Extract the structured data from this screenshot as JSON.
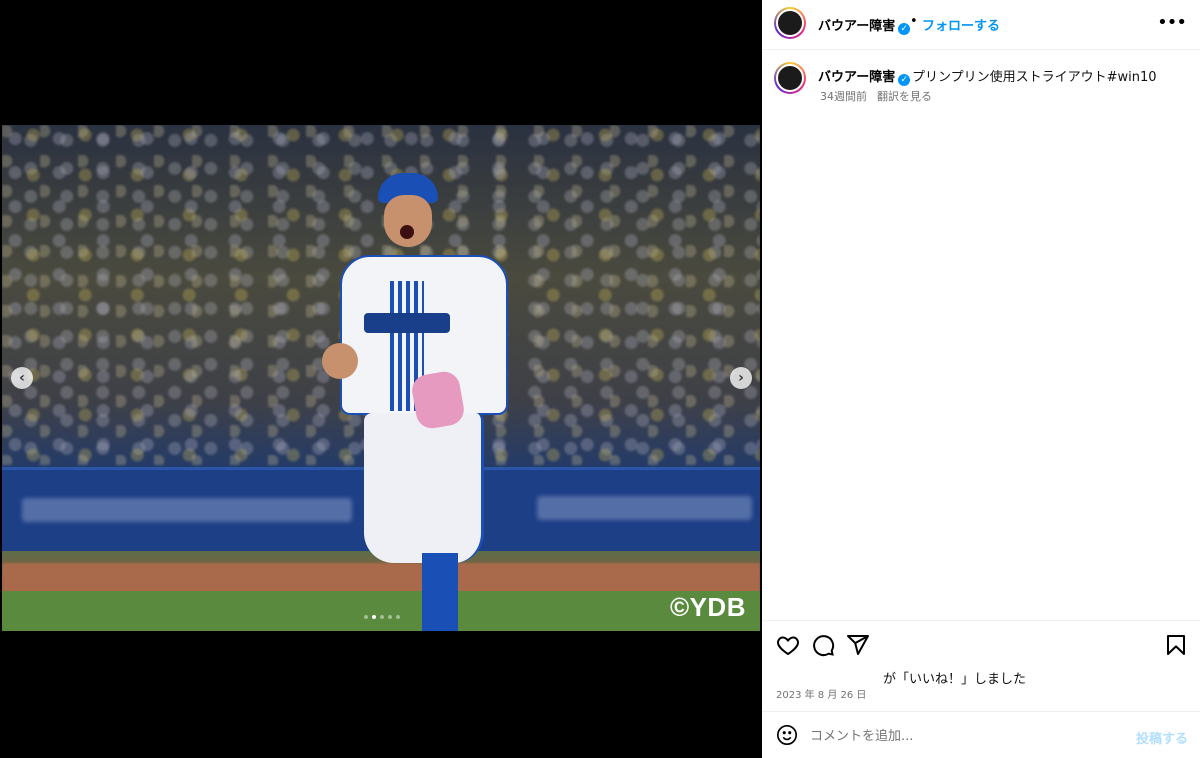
{
  "media": {
    "watermark": "©YDB",
    "carousel": {
      "dot_count": 5,
      "active_index": 1
    },
    "prev_glyph": "‹",
    "next_glyph": "›"
  },
  "header": {
    "username": "バウアー障害",
    "separator": "•",
    "follow_label": "フォローする",
    "more_glyph": "•••"
  },
  "caption": {
    "username": "バウアー障害",
    "text": "プリンプリン使用ストライアウト#win10",
    "age": "34週間前",
    "translate_label": "翻訳を見る"
  },
  "engagement": {
    "likes_text": "が「いいね！」しました",
    "date": "2023 年 8 月 26 日"
  },
  "comment": {
    "placeholder": "コメントを追加...",
    "post_label": "投稿する"
  },
  "colors": {
    "accent": "#0095f6",
    "post_disabled": "#b2dffc",
    "muted": "#737373"
  },
  "icons": [
    "heart-icon",
    "comment-icon",
    "share-icon",
    "bookmark-icon",
    "emoji-icon",
    "verified-icon",
    "chevron-left-icon",
    "chevron-right-icon",
    "more-icon"
  ]
}
